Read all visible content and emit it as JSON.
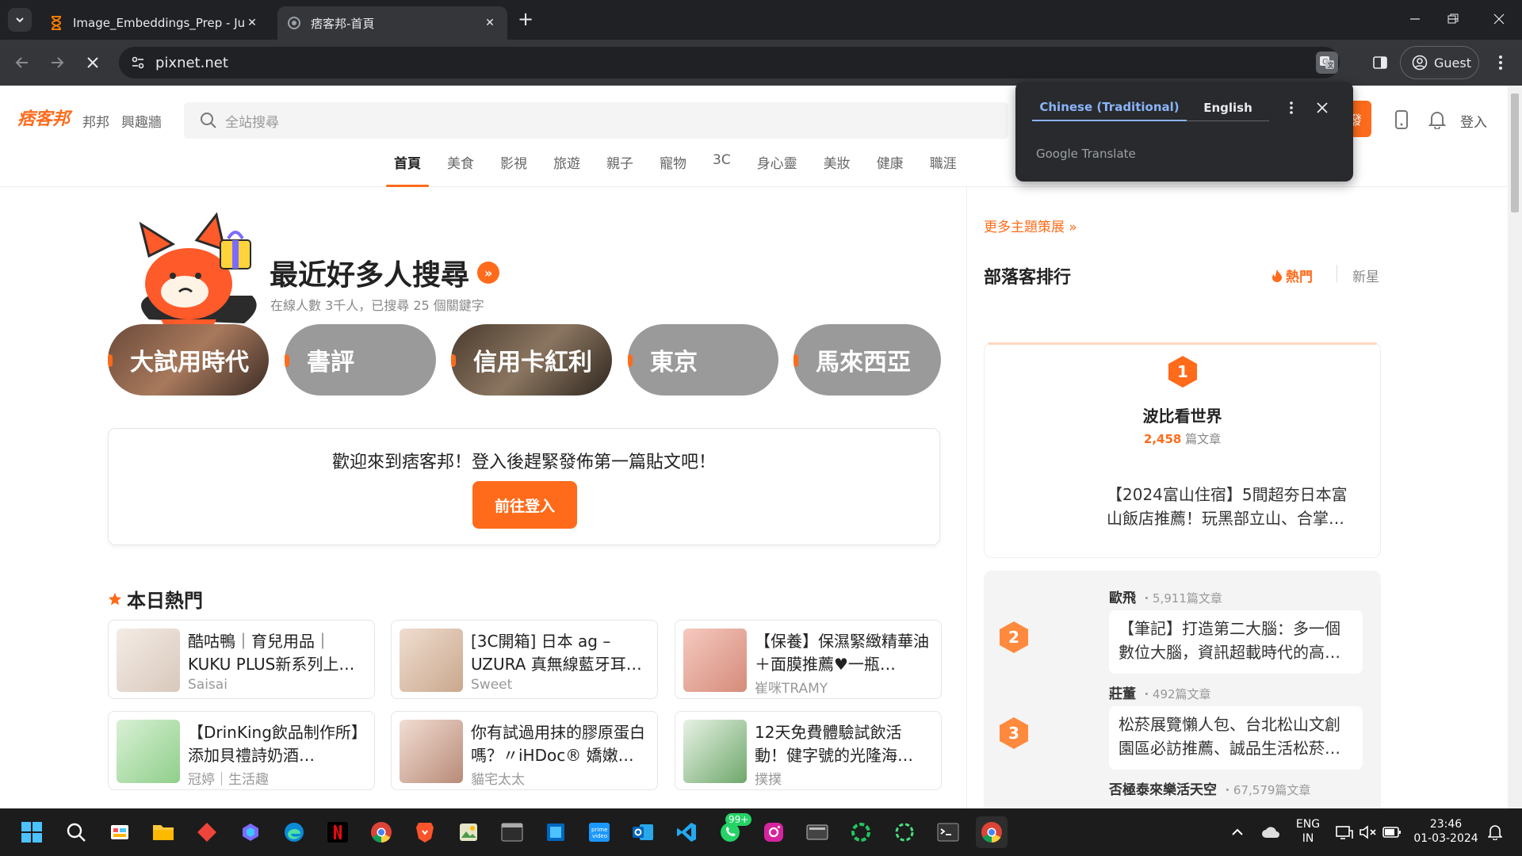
{
  "browser": {
    "tabs": [
      {
        "title": "Image_Embeddings_Prep - Jupy",
        "favicon": "hourglass-icon",
        "active": false
      },
      {
        "title": "痞客邦-首頁",
        "favicon": "pixnet-icon",
        "active": true
      }
    ],
    "url": "pixnet.net",
    "profile_label": "Guest"
  },
  "site": {
    "logo": "痞客邦",
    "header_links": [
      "邦邦",
      "興趣牆"
    ],
    "search_placeholder": "全站搜尋",
    "post_button": "發",
    "login": "登入",
    "categories": [
      "首頁",
      "美食",
      "影視",
      "旅遊",
      "親子",
      "寵物",
      "3C",
      "身心靈",
      "美妝",
      "健康",
      "職涯"
    ],
    "active_category": "首頁"
  },
  "hot_search": {
    "title": "最近好多人搜尋",
    "subtitle": "在線人數 3千人，已搜尋 25 個關鍵字",
    "keywords": [
      "大試用時代",
      "書評",
      "信用卡紅利",
      "東京",
      "馬來西亞"
    ]
  },
  "welcome": {
    "message": "歡迎來到痞客邦！登入後趕緊發佈第一篇貼文吧！",
    "button": "前往登入"
  },
  "today_hot": {
    "title": "本日熱門",
    "posts": [
      {
        "title": "酷咕鴨｜育兒用品｜KUKU PLUS新系列上…",
        "author": "Saisai"
      },
      {
        "title": "[3C開箱] 日本 ag – UZURA 真無線藍牙耳…",
        "author": "Sweet"
      },
      {
        "title": "【保養】保濕緊緻精華油＋面膜推薦♥一瓶…",
        "author": "崔咪TRAMY"
      },
      {
        "title": "【DrinKing飲品制作所】添加貝禮詩奶酒…",
        "author": "冠婷｜生活趣"
      },
      {
        "title": "你有試過用抹的膠原蛋白嗎？〃iHDoc® 嬌嫩…",
        "author": "貓宅太太"
      },
      {
        "title": "12天免費體驗試飲活動！健字號的光隆海…",
        "author": "撲撲"
      }
    ]
  },
  "sidebar": {
    "more_topics": "更多主題策展",
    "ranking_title": "部落客排行",
    "tab_hot": "熱門",
    "tab_new": "新星",
    "top1": {
      "rank": "1",
      "name": "波比看世界",
      "count": "2,458",
      "count_unit": "篇文章",
      "article": "【2024富山住宿】5間超夯日本富山飯店推薦！玩黑部立山、合掌…"
    },
    "others": [
      {
        "rank": "2",
        "name": "歐飛",
        "count": "・5,911篇文章",
        "article": "【筆記】打造第二大腦：多一個數位大腦，資訊超載時代的高…"
      },
      {
        "rank": "3",
        "name": "莊董",
        "count": "・492篇文章",
        "article": "松菸展覽懶人包、台北松山文創園區必訪推薦、誠品生活松菸…"
      },
      {
        "rank": "4",
        "name": "否極泰來樂活天空",
        "count": "・67,579篇文章",
        "article": ""
      }
    ]
  },
  "translate_popup": {
    "tab_source": "Chinese (Traditional)",
    "tab_target": "English",
    "footer": "Google Translate"
  },
  "taskbar": {
    "whatsapp_badge": "99+",
    "lang_line1": "ENG",
    "lang_line2": "IN",
    "time": "23:46",
    "date": "01-03-2024"
  },
  "colors": {
    "accent": "#ff6b1a",
    "chrome_dark": "#202124",
    "chrome_mid": "#35363a"
  }
}
